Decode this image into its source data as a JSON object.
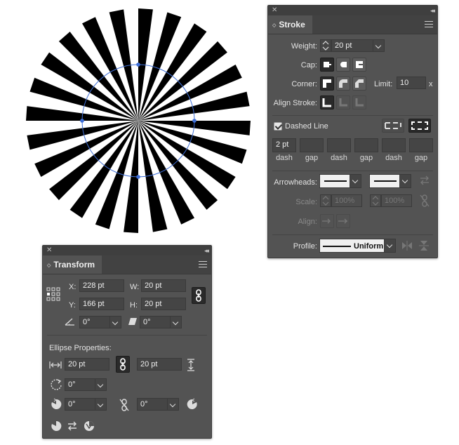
{
  "artwork": {
    "description_hidden": false
  },
  "stroke_panel": {
    "tab": "Stroke",
    "weight_label": "Weight:",
    "weight_value": "20 pt",
    "cap_label": "Cap:",
    "corner_label": "Corner:",
    "limit_label": "Limit:",
    "limit_value": "10",
    "limit_unit": "x",
    "align_label": "Align Stroke:",
    "dashed_label": "Dashed Line",
    "dashed_checked": true,
    "dash_fields": [
      {
        "value": "2 pt",
        "label": "dash"
      },
      {
        "value": "",
        "label": "gap"
      },
      {
        "value": "",
        "label": "dash"
      },
      {
        "value": "",
        "label": "gap"
      },
      {
        "value": "",
        "label": "dash"
      },
      {
        "value": "",
        "label": "gap"
      }
    ],
    "arrowheads_label": "Arrowheads:",
    "scale_label": "Scale:",
    "scale_value_1": "100%",
    "scale_value_2": "100%",
    "align_arrow_label": "Align:",
    "profile_label": "Profile:",
    "profile_value": "Uniform"
  },
  "transform_panel": {
    "tab": "Transform",
    "x_label": "X:",
    "x_value": "228 pt",
    "y_label": "Y:",
    "y_value": "166 pt",
    "w_label": "W:",
    "w_value": "20 pt",
    "h_label": "H:",
    "h_value": "20 pt",
    "rotate_value": "0°",
    "shear_value": "0°",
    "ellipse_label": "Ellipse Properties:",
    "ellipse_w": "20 pt",
    "ellipse_h": "20 pt",
    "ellipse_angle": "0°",
    "pie_start": "0°",
    "pie_end": "0°"
  },
  "colors": {
    "panel_bg": "#535353",
    "selection_blue": "#3e6fd8"
  }
}
